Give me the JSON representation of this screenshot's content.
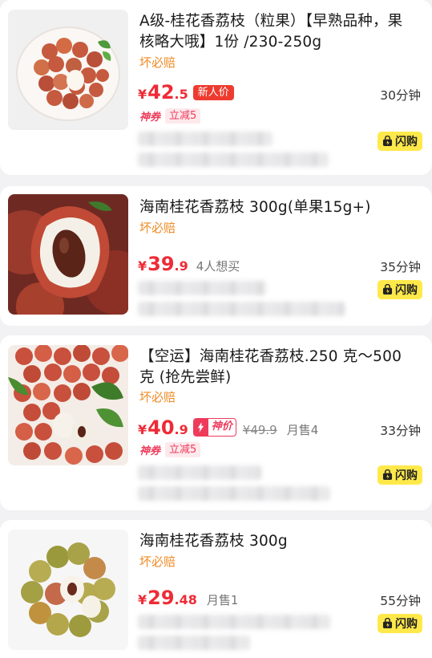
{
  "products": [
    {
      "title": "A级-桂花香荔枝（粒果）【早熟品种，果核略大哦】1份 /230-250g",
      "guarantee": "坏必赔",
      "price_int": "42",
      "price_dec": ".5",
      "badge": "新人价",
      "eta": "30分钟",
      "coupon_label": "神券",
      "coupon_discount": "立减5",
      "flash_label": "闪购",
      "image_icon": "lychee-plate-icon"
    },
    {
      "title": "海南桂花香荔枝 300g(单果15g+)",
      "guarantee": "坏必赔",
      "price_int": "39",
      "price_dec": ".9",
      "want": "4人想买",
      "eta": "35分钟",
      "flash_label": "闪购",
      "image_icon": "lychee-closeup-icon"
    },
    {
      "title": "【空运】海南桂花香荔枝.250 克～500克 (抢先尝鲜)",
      "guarantee": "坏必赔",
      "price_int": "40",
      "price_dec": ".9",
      "shen_tag": "神价",
      "old_price": "¥49.9",
      "sold": "月售4",
      "eta": "33分钟",
      "coupon_label": "神券",
      "coupon_discount": "立减5",
      "flash_label": "闪购",
      "image_icon": "lychee-pile-icon"
    },
    {
      "title": "海南桂花香荔枝 300g",
      "guarantee": "坏必赔",
      "price_int": "29",
      "price_dec": ".48",
      "sold": "月售1",
      "eta": "55分钟",
      "flash_label": "闪购",
      "image_icon": "lychee-bowl-icon"
    }
  ],
  "currency": "¥",
  "colors": {
    "price": "#ee2b36",
    "guarantee": "#f08a24",
    "flash_bg": "#ffe94a"
  }
}
